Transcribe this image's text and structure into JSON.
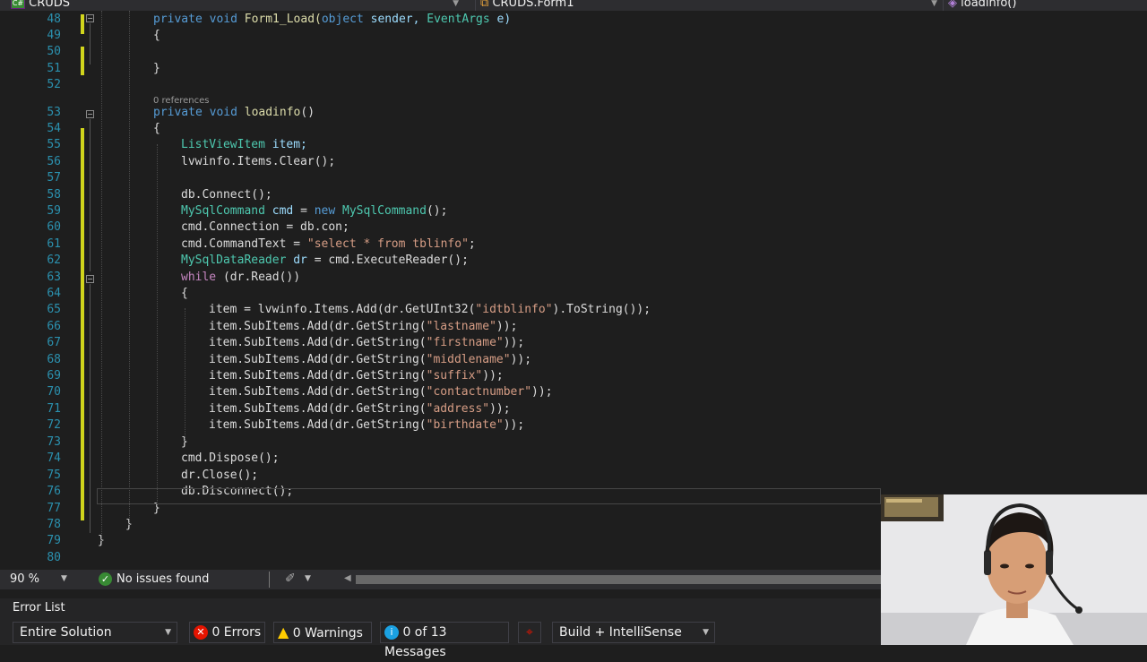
{
  "nav": {
    "project": "CRUDS",
    "class_name": "CRUDS.Form1",
    "member": "loadinfo()"
  },
  "editor": {
    "codelens": "0 references",
    "lines": [
      {
        "n": "48",
        "t": [
          [
            "private void ",
            "#569cd6"
          ],
          [
            "Form1_Load(",
            "#dcdcaa"
          ],
          [
            "object ",
            "#569cd6"
          ],
          [
            "sender, ",
            "#9cdcfe"
          ],
          [
            "EventArgs ",
            "#4ec9b0"
          ],
          [
            "e)",
            "#9cdcfe"
          ]
        ]
      },
      {
        "n": "49",
        "t": [
          [
            "{",
            "#dcdcdc"
          ]
        ]
      },
      {
        "n": "50",
        "t": []
      },
      {
        "n": "51",
        "t": [
          [
            "}",
            "#dcdcdc"
          ]
        ]
      },
      {
        "n": "52",
        "t": []
      },
      {
        "n": "53",
        "t": [
          [
            "private void ",
            "#569cd6"
          ],
          [
            "loadinfo",
            "#dcdcaa"
          ],
          [
            "()",
            "#dcdcdc"
          ]
        ]
      },
      {
        "n": "54",
        "t": [
          [
            "{",
            "#dcdcdc"
          ]
        ]
      },
      {
        "n": "55",
        "t": [
          [
            "ListViewItem ",
            "#4ec9b0"
          ],
          [
            "item;",
            "#9cdcfe"
          ]
        ]
      },
      {
        "n": "56",
        "t": [
          [
            "lvwinfo.Items.Clear();",
            "#dcdcdc"
          ]
        ]
      },
      {
        "n": "57",
        "t": []
      },
      {
        "n": "58",
        "t": [
          [
            "db.Connect();",
            "#dcdcdc"
          ]
        ]
      },
      {
        "n": "59",
        "t": [
          [
            "MySqlCommand ",
            "#4ec9b0"
          ],
          [
            "cmd ",
            "#9cdcfe"
          ],
          [
            "= ",
            "#dcdcdc"
          ],
          [
            "new ",
            "#569cd6"
          ],
          [
            "MySqlCommand",
            "#4ec9b0"
          ],
          [
            "();",
            "#dcdcdc"
          ]
        ]
      },
      {
        "n": "60",
        "t": [
          [
            "cmd.Connection = db.con;",
            "#dcdcdc"
          ]
        ]
      },
      {
        "n": "61",
        "t": [
          [
            "cmd.CommandText = ",
            "#dcdcdc"
          ],
          [
            "\"select * from tblinfo\"",
            "#d69d85"
          ],
          [
            ";",
            "#dcdcdc"
          ]
        ]
      },
      {
        "n": "62",
        "t": [
          [
            "MySqlDataReader ",
            "#4ec9b0"
          ],
          [
            "dr ",
            "#9cdcfe"
          ],
          [
            "= cmd.ExecuteReader();",
            "#dcdcdc"
          ]
        ]
      },
      {
        "n": "63",
        "t": [
          [
            "while ",
            "#c586c0"
          ],
          [
            "(dr.Read())",
            "#dcdcdc"
          ]
        ]
      },
      {
        "n": "64",
        "t": [
          [
            "{",
            "#dcdcdc"
          ]
        ]
      },
      {
        "n": "65",
        "t": [
          [
            "item = lvwinfo.Items.Add(dr.GetUInt32(",
            "#dcdcdc"
          ],
          [
            "\"idtblinfo\"",
            "#d69d85"
          ],
          [
            ").ToString());",
            "#dcdcdc"
          ]
        ]
      },
      {
        "n": "66",
        "t": [
          [
            "item.SubItems.Add(dr.GetString(",
            "#dcdcdc"
          ],
          [
            "\"lastname\"",
            "#d69d85"
          ],
          [
            "));",
            "#dcdcdc"
          ]
        ]
      },
      {
        "n": "67",
        "t": [
          [
            "item.SubItems.Add(dr.GetString(",
            "#dcdcdc"
          ],
          [
            "\"firstname\"",
            "#d69d85"
          ],
          [
            "));",
            "#dcdcdc"
          ]
        ]
      },
      {
        "n": "68",
        "t": [
          [
            "item.SubItems.Add(dr.GetString(",
            "#dcdcdc"
          ],
          [
            "\"middlename\"",
            "#d69d85"
          ],
          [
            "));",
            "#dcdcdc"
          ]
        ]
      },
      {
        "n": "69",
        "t": [
          [
            "item.SubItems.Add(dr.GetString(",
            "#dcdcdc"
          ],
          [
            "\"suffix\"",
            "#d69d85"
          ],
          [
            "));",
            "#dcdcdc"
          ]
        ]
      },
      {
        "n": "70",
        "t": [
          [
            "item.SubItems.Add(dr.GetString(",
            "#dcdcdc"
          ],
          [
            "\"contactnumber\"",
            "#d69d85"
          ],
          [
            "));",
            "#dcdcdc"
          ]
        ]
      },
      {
        "n": "71",
        "t": [
          [
            "item.SubItems.Add(dr.GetString(",
            "#dcdcdc"
          ],
          [
            "\"address\"",
            "#d69d85"
          ],
          [
            "));",
            "#dcdcdc"
          ]
        ]
      },
      {
        "n": "72",
        "t": [
          [
            "item.SubItems.Add(dr.GetString(",
            "#dcdcdc"
          ],
          [
            "\"birthdate\"",
            "#d69d85"
          ],
          [
            "));",
            "#dcdcdc"
          ]
        ]
      },
      {
        "n": "73",
        "t": [
          [
            "}",
            "#dcdcdc"
          ]
        ]
      },
      {
        "n": "74",
        "t": [
          [
            "cmd.Dispose();",
            "#dcdcdc"
          ]
        ]
      },
      {
        "n": "75",
        "t": [
          [
            "dr.Close();",
            "#dcdcdc"
          ]
        ]
      },
      {
        "n": "76",
        "t": [
          [
            "db.Disconnect();",
            "#dcdcdc"
          ]
        ]
      },
      {
        "n": "77",
        "t": [
          [
            "}",
            "#dcdcdc"
          ]
        ]
      },
      {
        "n": "78",
        "t": [
          [
            "}",
            "#dcdcdc"
          ]
        ]
      },
      {
        "n": "79",
        "t": [
          [
            "}",
            "#dcdcdc"
          ]
        ]
      },
      {
        "n": "80",
        "t": []
      }
    ]
  },
  "status": {
    "zoom": "90 %",
    "issues": "No issues found"
  },
  "error_list": {
    "title": "Error List",
    "scope": "Entire Solution",
    "errors": "0 Errors",
    "warnings": "0 Warnings",
    "messages": "0 of 13 Messages",
    "build_filter": "Build + IntelliSense"
  },
  "colors": {
    "keyword": "#569cd6",
    "type": "#4ec9b0",
    "method": "#dcdcaa",
    "string": "#d69d85",
    "control": "#c586c0",
    "line_number": "#2b91af",
    "change_marker": "#d1d51c"
  }
}
